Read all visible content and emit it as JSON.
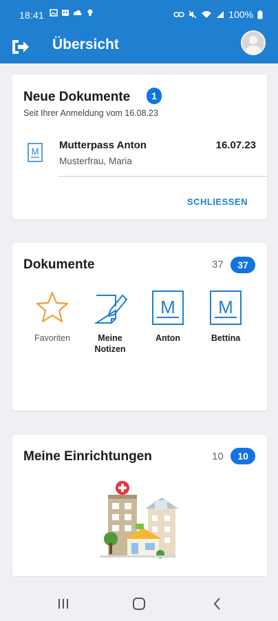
{
  "status_bar": {
    "time": "18:41",
    "battery": "100%",
    "left_icons": [
      "photo-icon",
      "calendar-icon",
      "cloud-icon",
      "bulb-icon"
    ],
    "right_icons": [
      "link-icon",
      "mute-icon",
      "wifi-icon",
      "signal-icon",
      "battery-icon"
    ]
  },
  "app_bar": {
    "title": "Übersicht",
    "logout_icon": "logout-icon",
    "avatar_icon": "avatar"
  },
  "new_documents": {
    "title": "Neue Dokumente",
    "badge": "1",
    "subtitle": "Seit Ihrer Anmeldung vom 16.08.23",
    "item": {
      "title": "Mutterpass Anton",
      "date": "16.07.23",
      "subtitle": "Musterfrau, Maria",
      "icon": "mutterpass-icon"
    },
    "close_label": "SCHLIESSEN"
  },
  "documents": {
    "title": "Dokumente",
    "count": "37",
    "badge": "37",
    "tiles": [
      {
        "label": "Favoriten",
        "icon": "star-icon"
      },
      {
        "label": "Meine Notizen",
        "icon": "notes-icon"
      },
      {
        "label": "Anton",
        "icon": "mutterpass-icon"
      },
      {
        "label": "Bettina",
        "icon": "mutterpass-icon"
      }
    ],
    "tile_icon_letter": "M"
  },
  "institutions": {
    "title": "Meine Einrichtungen",
    "count": "10",
    "badge": "10",
    "illustration": "hospital-buildings-illustration"
  },
  "nav_bar": {
    "buttons": [
      "recent-apps-icon",
      "home-icon",
      "back-icon"
    ]
  },
  "colors": {
    "primary": "#1f7fd1",
    "badge": "#1273e6",
    "star": "#f39c36",
    "background": "#eef0f4"
  }
}
